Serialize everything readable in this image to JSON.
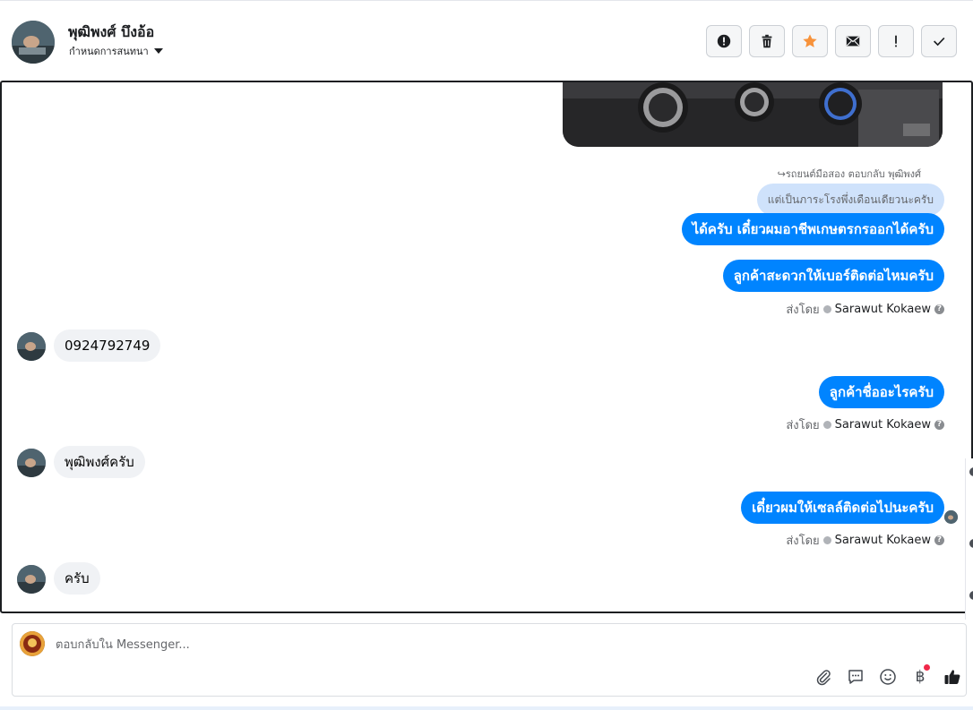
{
  "header": {
    "contact_name": "พุฒิพงศ์ บึงอ้อ",
    "assign_label": "กำหนดการสนทนา",
    "actions": [
      {
        "name": "report-spam",
        "icon": "exclamation-circle-icon"
      },
      {
        "name": "delete",
        "icon": "trash-icon"
      },
      {
        "name": "star",
        "icon": "star-icon"
      },
      {
        "name": "mark-unread",
        "icon": "envelope-icon"
      },
      {
        "name": "follow-up",
        "icon": "exclamation-icon"
      },
      {
        "name": "mark-done",
        "icon": "check-icon"
      }
    ],
    "star_color": "#f7923a"
  },
  "conversation": {
    "reply_note": "↪รถยนต์มือสอง ตอบกลับ พุฒิพงศ์",
    "reply_quote": "แต่เป็นภาระโรงพึ่งเดือนเดียวนะครับ",
    "messages": [
      {
        "dir": "out",
        "text": "ได้ครับ เดี๋ยวผมอาชีพเกษตรกรออกได้ครับ"
      },
      {
        "dir": "out",
        "text": "ลูกค้าสะดวกให้เบอร์ติดต่อไหมครับ"
      },
      {
        "dir": "in",
        "text": "0924792749"
      },
      {
        "dir": "out",
        "text": "ลูกค้าชื่ออะไรครับ"
      },
      {
        "dir": "in",
        "text": "พุฒิพงศ์ครับ"
      },
      {
        "dir": "out",
        "text": "เดี๋ยวผมให้เซลล์ติดต่อไปนะครับ"
      },
      {
        "dir": "in",
        "text": "ครับ"
      }
    ],
    "sent_by_prefix": "ส่งโดย",
    "sender_name": "Sarawut Kokaew",
    "help_glyph": "?"
  },
  "composer": {
    "placeholder": "ตอบกลับใน Messenger...",
    "tools": [
      "attach-icon",
      "saved-replies-icon",
      "emoji-icon",
      "payment-icon",
      "like-icon"
    ],
    "baht_symbol": "฿"
  },
  "colors": {
    "outgoing": "#0084ff",
    "incoming": "#f0f2f5",
    "quote": "#cfe2fb"
  }
}
